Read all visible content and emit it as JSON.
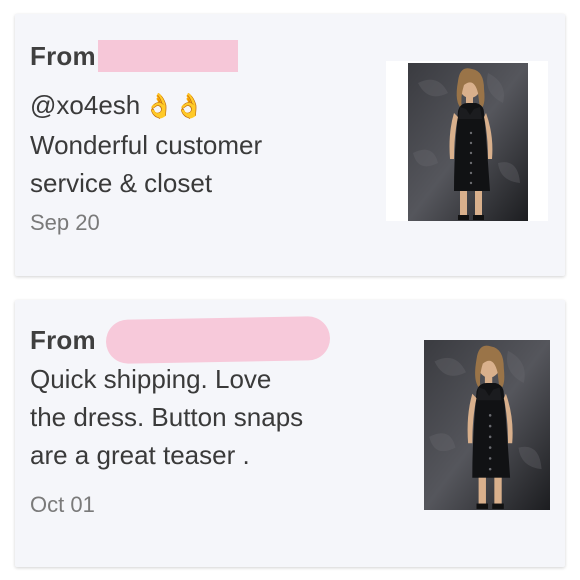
{
  "reviews": [
    {
      "from_label": "From",
      "handle": "@xo4esh",
      "emoji": "👌👌",
      "text": "Wonderful customer\nservice & closet",
      "date": "Sep 20"
    },
    {
      "from_label": "From",
      "text": "Quick shipping. Love\nthe dress. Button snaps\nare a great teaser .",
      "date": "Oct 01"
    }
  ],
  "colors": {
    "card_background": "#f5f6fa",
    "redaction_pink": "#f6c7d8",
    "text_primary": "#3a3a3a",
    "text_secondary": "#7a7a7a"
  }
}
